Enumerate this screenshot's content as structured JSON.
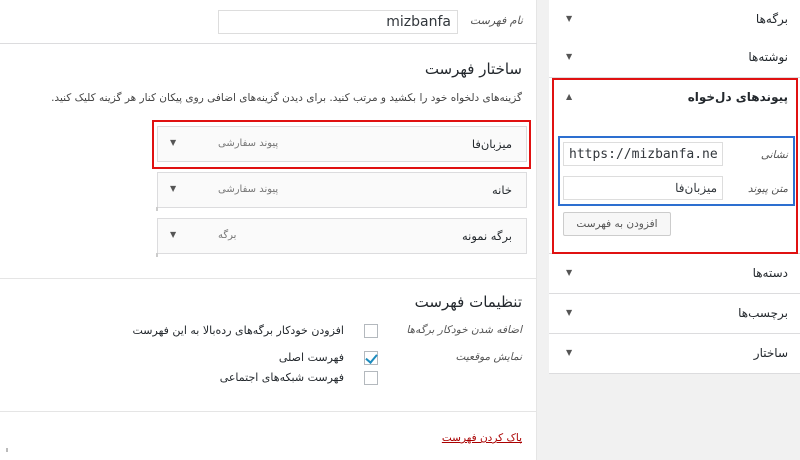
{
  "menu_editor": {
    "menu_name_label": "نام فهرست",
    "menu_name_value": "mizbanfa",
    "structure_title": "ساختار فهرست",
    "structure_help": "گزینه‌های دلخواه خود را بکشید و مرتب کنید. برای دیدن گزینه‌های اضافی روی پیکان کنار هر گزینه کلیک کنید.",
    "items": [
      {
        "title": "میزبان‌فا",
        "type": "پیوند سفارشی"
      },
      {
        "title": "خانه",
        "type": "پیوند سفارشی"
      },
      {
        "title": "برگه نمونه",
        "type": "برگه"
      }
    ],
    "settings_title": "تنظیمات فهرست",
    "auto_add_label": "اضافه شدن خودکار برگه‌ها",
    "auto_add_text": "افزودن خودکار برگه‌های رده‌بالا به این فهرست",
    "location_label": "نمایش موقعیت",
    "location_primary": "فهرست اصلی",
    "location_social": "فهرست شبکه‌های اجتماعی",
    "delete_link": "پاک کردن فهرست"
  },
  "sidebar": {
    "sections": [
      {
        "label": "برگه‌ها"
      },
      {
        "label": "نوشته‌ها"
      },
      {
        "label": "پیوندهای دل‌خواه"
      },
      {
        "label": "دسته‌ها"
      },
      {
        "label": "برچسب‌ها"
      },
      {
        "label": "ساختار"
      }
    ],
    "custom_links": {
      "url_label": "نشانی",
      "url_value": "https://mizbanfa.net",
      "text_label": "متن پیوند",
      "text_value": "میزبان‌فا",
      "add_button": "افزودن به فهرست"
    }
  },
  "icons": {
    "collapsed": "triangle-down",
    "expanded": "triangle-up"
  },
  "colors": {
    "highlight_red": "#e01111",
    "highlight_blue": "#2d6fd0",
    "link_delete": "#aa0000",
    "check": "#1e8cbe"
  }
}
